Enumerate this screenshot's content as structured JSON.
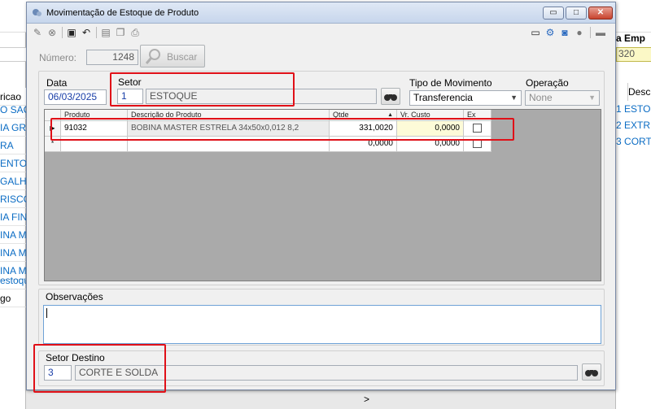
{
  "window": {
    "title": "Movimentação de Estoque de Produto",
    "buttons": {
      "minimize": "▭",
      "maximize": "□",
      "close": "✕"
    }
  },
  "toolbar": {
    "icons": [
      "edit-icon",
      "cancel-icon",
      "save-icon",
      "undo-icon",
      "new-icon",
      "copy-icon",
      "print-icon"
    ],
    "right_icons": [
      "list-icon",
      "settings-icon",
      "export-icon",
      "user-icon",
      "menu-icon"
    ]
  },
  "numero": {
    "label": "Número:",
    "value": "1248"
  },
  "search_button": {
    "label": "Buscar"
  },
  "data": {
    "label": "Data",
    "value": "06/03/2025"
  },
  "setor": {
    "label": "Setor",
    "code": "1",
    "name": "ESTOQUE"
  },
  "tipo_movimento": {
    "label": "Tipo de Movimento",
    "value": "Transferencia"
  },
  "operacao": {
    "label": "Operação",
    "value": "None"
  },
  "grid": {
    "columns": [
      "Produto",
      "Descrição do Produto",
      "Qtde",
      "Vr. Custo",
      "Ex"
    ],
    "rows": [
      {
        "indicator": "▶",
        "produto": "91032",
        "descricao": "BOBINA MASTER ESTRELA 34x50x0,012 8,2",
        "qtde": "331,0020",
        "custo": "0,0000",
        "ex": false
      },
      {
        "indicator": "*",
        "produto": "",
        "descricao": "",
        "qtde": "0,0000",
        "custo": "0,0000",
        "ex": false
      }
    ]
  },
  "observacoes": {
    "label": "Observações",
    "value": ""
  },
  "setor_destino": {
    "label": "Setor Destino",
    "code": "3",
    "name": "CORTE E SOLDA"
  },
  "background": {
    "left_header": "ricao",
    "left_items": [
      "O SACO",
      "IA GRO",
      "RA",
      "ENTO I",
      "GALHA",
      "RISCO",
      "IA FINA",
      "INA MA",
      "INA MA",
      "INA MA"
    ],
    "left_lower_link": "estoque",
    "left_lower_label": "go",
    "right_top_label": "a",
    "right_top_label2": "Emp",
    "right_value": "320",
    "right_col_header": "Desc",
    "right_rows": [
      {
        "num": "1",
        "text": "ESTO"
      },
      {
        "num": "2",
        "text": "EXTR"
      },
      {
        "num": "3",
        "text": "CORT"
      }
    ],
    "bottom_arrow": ">"
  },
  "colors": {
    "highlight": "#e01018",
    "link": "#0b6cc4",
    "value_blue": "#1a3fa8"
  }
}
